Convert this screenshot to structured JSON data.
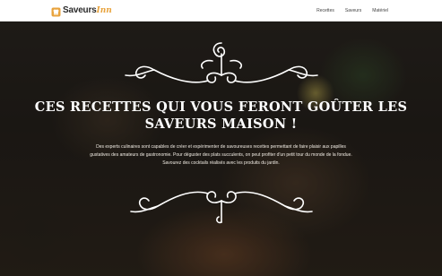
{
  "header": {
    "logo_main": "Saveurs",
    "logo_accent": "Inn",
    "nav": [
      {
        "label": "Recettes"
      },
      {
        "label": "Saveurs"
      },
      {
        "label": "Matériel"
      }
    ]
  },
  "hero": {
    "title": "Ces recettes qui vous feront goûter les saveurs maison !",
    "description": "Des experts culinaires sont capables de créer et expérimenter de savoureuses recettes permettant de faire plaisir aux papilles gustatives des amateurs de gastronomie. Pour déguster des plats succulents, on peut profiter d'un petit tour du monde de la fondue. Savourez des cocktails réalisés avec les produits du jardin."
  },
  "colors": {
    "accent": "#e8a33d",
    "text_light": "#ffffff",
    "header_bg": "#ffffff"
  },
  "icons": [
    "chef-hat-icon",
    "ornament-divider-top",
    "ornament-divider-bottom"
  ]
}
